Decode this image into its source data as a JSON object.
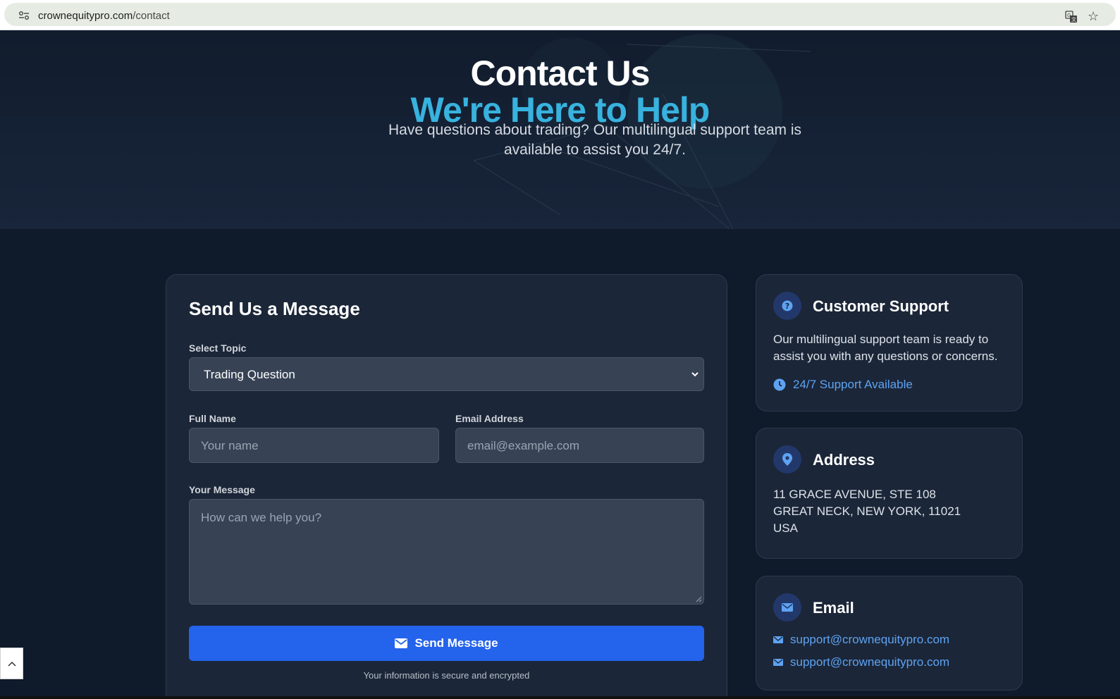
{
  "browser": {
    "url_domain": "crownequitypro.com",
    "url_path": "/contact"
  },
  "hero": {
    "title": "Contact Us",
    "subtitle": "We're Here to Help",
    "description": "Have questions about trading? Our multilingual support team is available to assist you 24/7."
  },
  "form": {
    "title": "Send Us a Message",
    "topic_label": "Select Topic",
    "topic_value": "Trading Question",
    "name_label": "Full Name",
    "name_placeholder": "Your name",
    "email_label": "Email Address",
    "email_placeholder": "email@example.com",
    "message_label": "Your Message",
    "message_placeholder": "How can we help you?",
    "submit_label": "Send Message",
    "secure_note": "Your information is secure and encrypted"
  },
  "support_card": {
    "title": "Customer Support",
    "text": "Our multilingual support team is ready to assist you with any questions or concerns.",
    "availability": "24/7 Support Available",
    "icon": "question-circle-icon"
  },
  "address_card": {
    "title": "Address",
    "line1": "11 GRACE AVENUE, STE 108",
    "line2": "GREAT NECK, NEW YORK, 11021",
    "line3": "USA",
    "icon": "map-pin-icon"
  },
  "email_card": {
    "title": "Email",
    "email1": "support@crownequitypro.com",
    "email2": "support@crownequitypro.com",
    "icon": "envelope-icon"
  },
  "colors": {
    "accent": "#38b2de",
    "button": "#2463eb",
    "link": "#5ea3f2",
    "background": "#0f1a2b",
    "card": "#1b2638"
  }
}
